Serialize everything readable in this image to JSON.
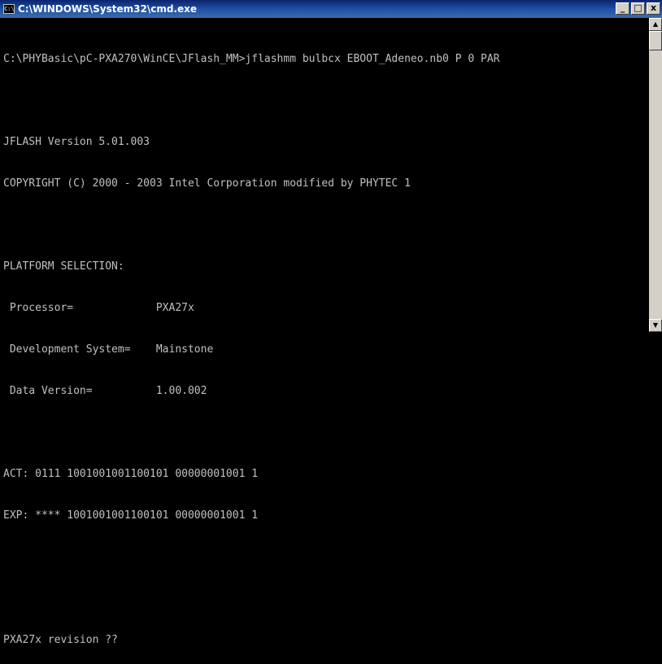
{
  "window": {
    "title": "C:\\WINDOWS\\System32\\cmd.exe",
    "icon_text": "C:\\",
    "minimize": "_",
    "maximize": "□",
    "close": "x"
  },
  "console": {
    "lines": [
      "C:\\PHYBasic\\pC-PXA270\\WinCE\\JFlash_MM>jflashmm bulbcx EBOOT_Adeneo.nb0 P 0 PAR",
      "",
      "JFLASH Version 5.01.003",
      "COPYRIGHT (C) 2000 - 2003 Intel Corporation modified by PHYTEC 1",
      "",
      "PLATFORM SELECTION:",
      " Processor=             PXA27x",
      " Development System=    Mainstone",
      " Data Version=          1.00.002",
      "",
      "ACT: 0111 1001001001100101 00000001001 1",
      "EXP: **** 1001001001100101 00000001001 1",
      "",
      "",
      "PXA27x revision ??"
    ]
  },
  "scrollbar": {
    "up": "▲",
    "down": "▼"
  }
}
